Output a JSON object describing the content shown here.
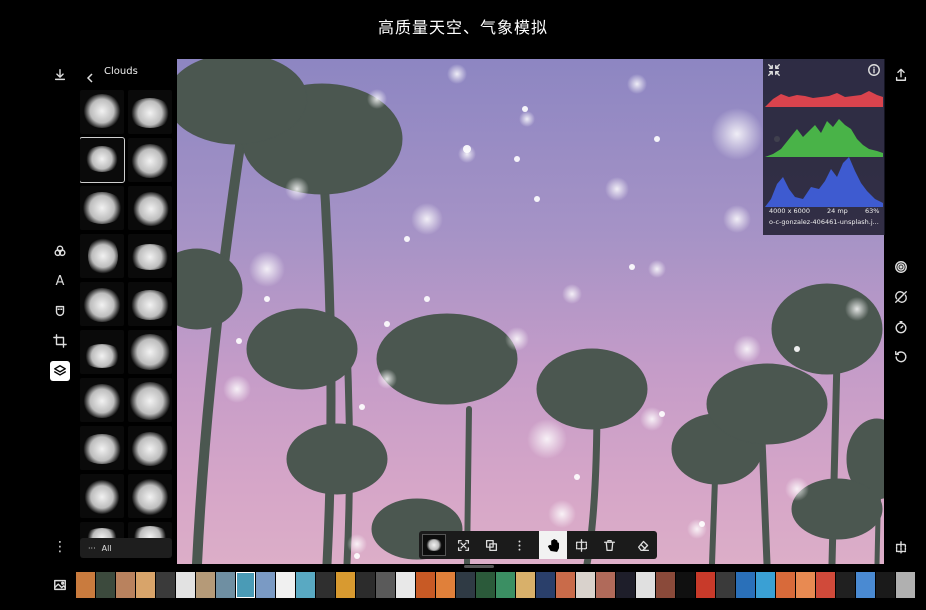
{
  "header": {
    "title": "高质量天空、气象模拟"
  },
  "left_toolbar": {
    "items": [
      {
        "name": "download-icon"
      },
      {
        "name": "filters-icon"
      },
      {
        "name": "text-icon",
        "glyph": "A"
      },
      {
        "name": "mask-icon"
      },
      {
        "name": "crop-icon"
      },
      {
        "name": "layers-icon"
      },
      {
        "name": "more-icon",
        "glyph": "⋮"
      }
    ]
  },
  "panel": {
    "title": "Clouds",
    "all_button": {
      "dots": "···",
      "label": "All"
    }
  },
  "histogram": {
    "dimensions": "4000 x 6000",
    "megapixels": "24 mp",
    "quality": "63%",
    "filename": "o-c-gonzalez-406461-unsplash.j..."
  },
  "right_toolbar": {
    "items": [
      "share-icon",
      "target-icon",
      "no-sync-icon",
      "timer-icon",
      "undo-icon",
      "compare-icon"
    ]
  },
  "bottom_toolbar": {
    "items": [
      "layer-thumb",
      "fit-icon",
      "duplicate-icon",
      "more-icon",
      "hand-icon",
      "split-icon",
      "trash-icon",
      "eraser-icon"
    ]
  },
  "filmstrip": {
    "colors": [
      "#c97b3e",
      "#3c4a3d",
      "#b9825e",
      "#d8a46a",
      "#3a3a3a",
      "#e2e2e2",
      "#b59a78",
      "#6f8fa2",
      "#4a9bb6",
      "#7a9ac4",
      "#f0f0f0",
      "#59a9c2",
      "#2f2f2f",
      "#d89a30",
      "#2c2c2c",
      "#5a5a5a",
      "#e8e8e8",
      "#c85a25",
      "#e0803a",
      "#2f3a44",
      "#2b5a3a",
      "#3b8f63",
      "#d8b06a",
      "#2a3f6a",
      "#c96b4a",
      "#d9d2cc",
      "#b06a5a",
      "#1e1e2a",
      "#e0e0e0",
      "#8a4a3a",
      "#101010",
      "#c83a2a",
      "#3a3a3a",
      "#2a70b9",
      "#3aa0d4",
      "#d86a3a",
      "#e88a52",
      "#d04a3a",
      "#202020",
      "#4a8ad2",
      "#1a1a1a",
      "#b0b0b0",
      "#1a3ab0",
      "#1e4ad0",
      "#2a2a2a",
      "#2a5a8a",
      "#6a6a6a",
      "#d0d0d0"
    ]
  },
  "accent": {
    "selected": "#ffffff",
    "hist_red": "#d9434d",
    "hist_green": "#49b348",
    "hist_blue": "#3e5bd0"
  }
}
